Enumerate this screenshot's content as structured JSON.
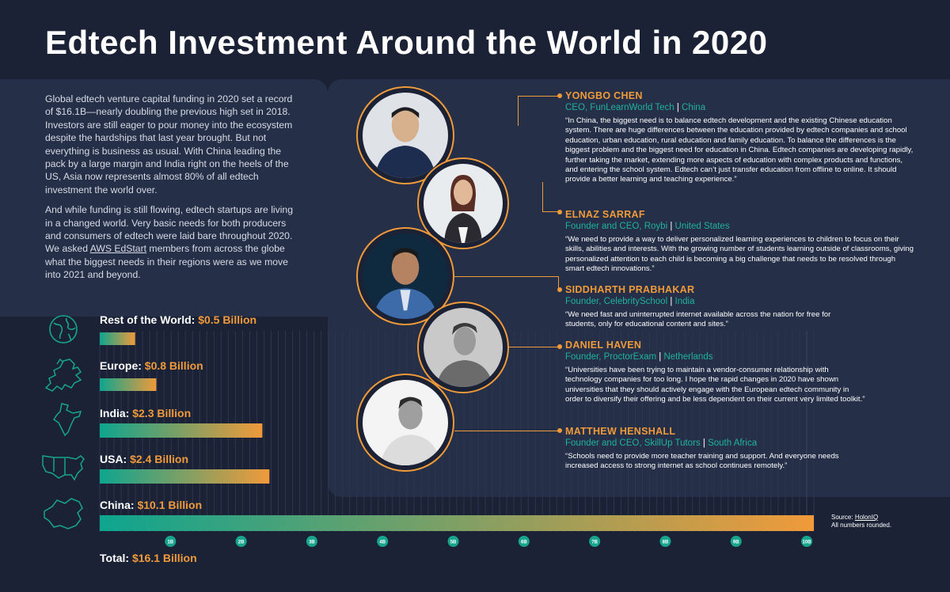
{
  "title": "Edtech Investment Around the World in 2020",
  "intro": {
    "p1": "Global edtech venture capital funding in 2020 set a record of $16.1B—nearly doubling the previous high set in 2018. Investors are still eager to pour money into the ecosystem despite the hardships that last year brought. But not everything is business as usual. With China leading the pack by a large margin and India right on the heels of the US, Asia now represents almost 80% of all edtech investment the world over.",
    "p2_before": "And while funding is still flowing, edtech startups are living in a changed world. Very basic needs for both producers and consumers of edtech were laid bare throughout 2020. We asked ",
    "p2_link": "AWS EdStart",
    "p2_after": " members from across the globe what the biggest needs in their regions were as we move into 2021 and beyond."
  },
  "chart_data": {
    "type": "bar",
    "orientation": "horizontal",
    "categories": [
      "Rest of the World",
      "Europe",
      "India",
      "USA",
      "China"
    ],
    "values": [
      0.5,
      0.8,
      2.3,
      2.4,
      10.1
    ],
    "unit": "Billion",
    "value_labels": [
      "$0.5 Billion",
      "$0.8 Billion",
      "$2.3 Billion",
      "$2.4 Billion",
      "$10.1 Billion"
    ],
    "xlim": [
      0,
      10.1
    ],
    "xticks": [
      1,
      2,
      3,
      4,
      5,
      6,
      7,
      8,
      9,
      10
    ],
    "xtick_labels": [
      "1B",
      "2B",
      "3B",
      "4B",
      "5B",
      "6B",
      "7B",
      "8B",
      "9B",
      "10B"
    ],
    "grid": true,
    "colors": {
      "start": "#0ea58f",
      "end": "#f09a3a"
    }
  },
  "icons": [
    "globe-icon",
    "europe-map-icon",
    "india-map-icon",
    "usa-map-icon",
    "china-map-icon"
  ],
  "total": {
    "label": "Total:",
    "value": "$16.1 Billion"
  },
  "source": {
    "label": "Source:",
    "name": "HolonIQ",
    "note": "All numbers rounded."
  },
  "people": [
    {
      "name": "YONGBO CHEN",
      "role": "CEO, FunLearnWorld Tech",
      "country": "China",
      "quote": "“In China, the biggest need is to balance edtech development and the existing Chinese education system. There are huge differences between the education provided by edtech companies and school education, urban education, rural education and family education. To balance the differences is the biggest problem and the biggest need for education in China. Edtech companies are developing rapidly, further taking the market, extending more aspects of education with complex products and functions, and entering the school system. Edtech can’t just transfer education from offline to online. It should provide a better learning and teaching experience.”"
    },
    {
      "name": "ELNAZ SARRAF",
      "role": "Founder and CEO, Roybi",
      "country": "United States",
      "quote": "“We need to provide a way to deliver personalized learning experiences to children to focus on their skills, abilities and interests. With the growing number of students learning outside of classrooms, giving personalized attention to each child is becoming a big challenge that needs to be resolved through smart edtech innovations.”"
    },
    {
      "name": "SIDDHARTH PRABHAKAR",
      "role": "Founder, CelebritySchool",
      "country": "India",
      "quote": "“We need fast and uninterrupted internet available across the nation for free for students, only for educational content and sites.”"
    },
    {
      "name": "DANIEL HAVEN",
      "role": "Founder, ProctorExam",
      "country": "Netherlands",
      "quote": "“Universities have been trying to maintain a vendor-consumer relationship with technology companies for too long. I hope the rapid changes in 2020 have shown universities that they should actively engage with the European edtech community in order to diversify their offering and be less dependent on their current very limited toolkit.”"
    },
    {
      "name": "MATTHEW HENSHALL",
      "role": "Founder and CEO, SkillUp Tutors",
      "country": "South Africa",
      "quote": "“Schools need to provide more teacher training and support. And everyone needs increased access to strong internet as school continues remotely.”"
    }
  ],
  "colors": {
    "background": "#1b2236",
    "panel": "#252f47",
    "accent_orange": "#f09a3a",
    "accent_teal": "#20b2a0"
  }
}
